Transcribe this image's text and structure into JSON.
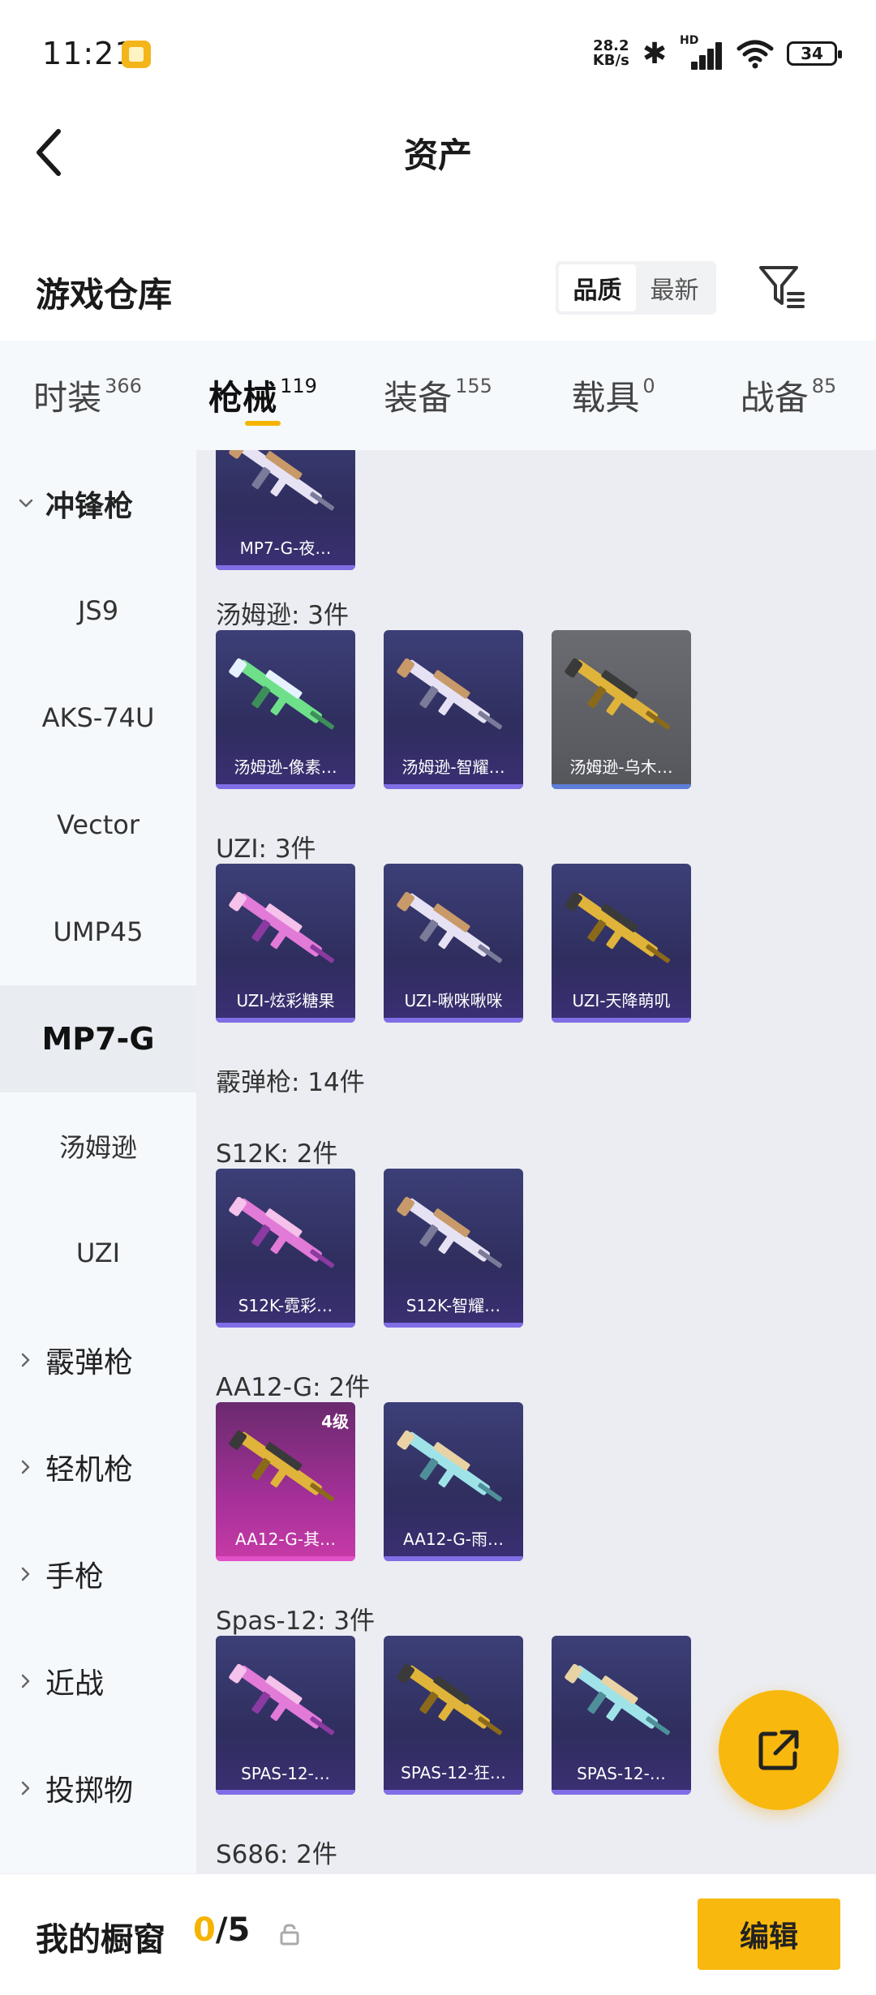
{
  "status": {
    "time": "11:21",
    "speed_value": "28.2",
    "speed_unit": "KB/s",
    "network": "HD",
    "wifi_level": "6",
    "battery": "34"
  },
  "header": {
    "title": "资产"
  },
  "warehouse": {
    "title": "游戏仓库",
    "sort_options": [
      "品质",
      "最新"
    ],
    "active_sort": "品质"
  },
  "tabs": [
    {
      "label": "时装",
      "count": "366",
      "active": false
    },
    {
      "label": "枪械",
      "count": "119",
      "active": true
    },
    {
      "label": "装备",
      "count": "155",
      "active": false
    },
    {
      "label": "载具",
      "count": "0",
      "active": false
    },
    {
      "label": "战备",
      "count": "85",
      "active": false
    }
  ],
  "sidebar": [
    {
      "label": "冲锋枪",
      "kind": "group",
      "open": true
    },
    {
      "label": "JS9",
      "kind": "item"
    },
    {
      "label": "AKS-74U",
      "kind": "item"
    },
    {
      "label": "Vector",
      "kind": "item"
    },
    {
      "label": "UMP45",
      "kind": "item"
    },
    {
      "label": "MP7-G",
      "kind": "item",
      "active": true
    },
    {
      "label": "汤姆逊",
      "kind": "item"
    },
    {
      "label": "UZI",
      "kind": "item"
    },
    {
      "label": "霰弹枪",
      "kind": "group"
    },
    {
      "label": "轻机枪",
      "kind": "group"
    },
    {
      "label": "手枪",
      "kind": "group"
    },
    {
      "label": "近战",
      "kind": "group"
    },
    {
      "label": "投掷物",
      "kind": "group"
    }
  ],
  "sections": [
    {
      "title": "汤姆逊: 3件",
      "items": [
        {
          "label": "汤姆逊-像素…",
          "tint": "purple",
          "art": "green"
        },
        {
          "label": "汤姆逊-智耀…",
          "tint": "purple",
          "art": "white"
        },
        {
          "label": "汤姆逊-乌木…",
          "tint": "grey",
          "art": "gold"
        }
      ]
    },
    {
      "title": "UZI: 3件",
      "items": [
        {
          "label": "UZI-炫彩糖果",
          "tint": "purple",
          "art": "pink"
        },
        {
          "label": "UZI-啾咪啾咪",
          "tint": "purple",
          "art": "white"
        },
        {
          "label": "UZI-天降萌叽",
          "tint": "purple",
          "art": "gold"
        }
      ]
    },
    {
      "title": "霰弹枪: 14件",
      "items": []
    },
    {
      "title": "S12K: 2件",
      "items": [
        {
          "label": "S12K-霓彩…",
          "tint": "purple",
          "art": "pink"
        },
        {
          "label": "S12K-智耀…",
          "tint": "purple",
          "art": "white"
        }
      ]
    },
    {
      "title": "AA12-G: 2件",
      "items": [
        {
          "label": "AA12-G-其…",
          "tint": "pink",
          "art": "gold",
          "badge": "4级"
        },
        {
          "label": "AA12-G-雨…",
          "tint": "purple",
          "art": "cyan"
        }
      ]
    },
    {
      "title": "Spas-12: 3件",
      "items": [
        {
          "label": "SPAS-12-…",
          "tint": "purple",
          "art": "pink"
        },
        {
          "label": "SPAS-12-狂…",
          "tint": "purple",
          "art": "gold"
        },
        {
          "label": "SPAS-12-…",
          "tint": "purple",
          "art": "cyan"
        }
      ]
    },
    {
      "title": "S686: 2件",
      "items": []
    }
  ],
  "partial_top_card": {
    "label": "MP7-G-夜…",
    "tint": "purple",
    "art": "white"
  },
  "showcase": {
    "title": "我的橱窗",
    "current": "0",
    "total": "/5",
    "edit_label": "编辑"
  },
  "colors": {
    "accent": "#f8b80d",
    "accent_text": "#f5b400",
    "sidebar_bg": "#f6f9fc",
    "content_bg": "#ebedf2"
  }
}
